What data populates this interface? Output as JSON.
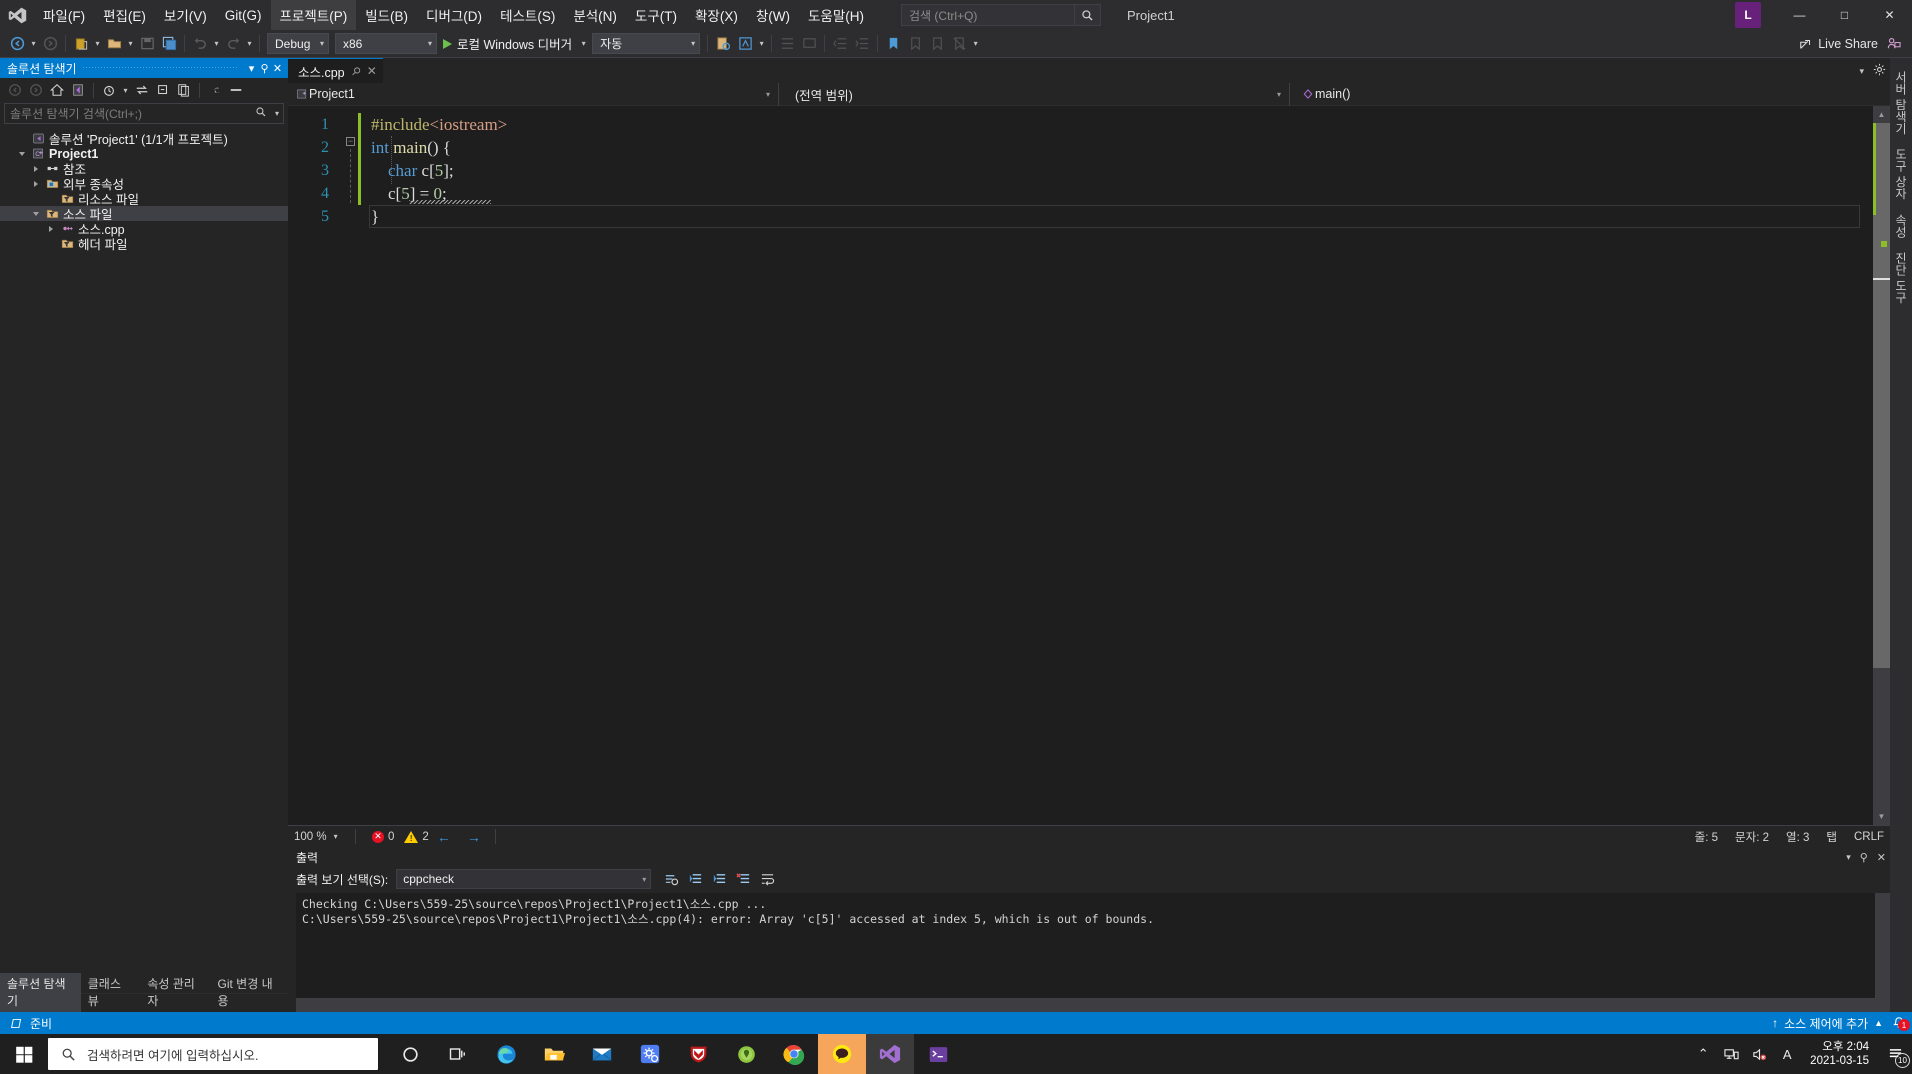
{
  "menubar": {
    "logo_icon": "visual-studio-logo",
    "items": [
      {
        "label": "파일(F)",
        "active": false
      },
      {
        "label": "편집(E)",
        "active": false
      },
      {
        "label": "보기(V)",
        "active": false
      },
      {
        "label": "Git(G)",
        "active": false
      },
      {
        "label": "프로젝트(P)",
        "active": true
      },
      {
        "label": "빌드(B)",
        "active": false
      },
      {
        "label": "디버그(D)",
        "active": false
      },
      {
        "label": "테스트(S)",
        "active": false
      },
      {
        "label": "분석(N)",
        "active": false
      },
      {
        "label": "도구(T)",
        "active": false
      },
      {
        "label": "확장(X)",
        "active": false
      },
      {
        "label": "창(W)",
        "active": false
      },
      {
        "label": "도움말(H)",
        "active": false
      }
    ],
    "search_placeholder": "검색 (Ctrl+Q)",
    "project_label": "Project1",
    "avatar_initial": "L",
    "minimize": "—",
    "maximize": "□",
    "close": "✕"
  },
  "toolbar": {
    "config": "Debug",
    "platform": "x86",
    "run_label": "로컬 Windows 디버거",
    "auto_label": "자동",
    "live_share": "Live Share"
  },
  "solution_explorer": {
    "title": "솔루션 탐색기",
    "pin_icon": "pin-icon",
    "close_icon": "close-icon",
    "minimize_icon": "chevron-down-icon",
    "search_placeholder": "솔루션 탐색기 검색(Ctrl+;)",
    "tree": [
      {
        "label": "솔루션 'Project1' (1/1개 프로젝트)",
        "indent": 0,
        "twisty": "none",
        "icon": "solution-icon",
        "bold": false,
        "selected": false
      },
      {
        "label": "Project1",
        "indent": 1,
        "twisty": "open",
        "icon": "cpp-project-icon",
        "bold": true,
        "selected": false
      },
      {
        "label": "참조",
        "indent": 2,
        "twisty": "closed",
        "icon": "references-icon",
        "bold": false,
        "selected": false
      },
      {
        "label": "외부 종속성",
        "indent": 2,
        "twisty": "closed",
        "icon": "ext-dep-icon",
        "bold": false,
        "selected": false
      },
      {
        "label": "리소스 파일",
        "indent": 3,
        "twisty": "none",
        "icon": "filter-folder-icon",
        "bold": false,
        "selected": false
      },
      {
        "label": "소스 파일",
        "indent": 2,
        "twisty": "open",
        "icon": "filter-folder-icon",
        "bold": false,
        "selected": true
      },
      {
        "label": "소스.cpp",
        "indent": 3,
        "twisty": "closed",
        "icon": "cpp-file-icon",
        "bold": false,
        "selected": false
      },
      {
        "label": "헤더 파일",
        "indent": 3,
        "twisty": "none",
        "icon": "filter-folder-icon",
        "bold": false,
        "selected": false
      }
    ],
    "bottom_tabs": [
      {
        "label": "솔루션 탐색기",
        "active": true
      },
      {
        "label": "클래스 뷰",
        "active": false
      },
      {
        "label": "속성 관리자",
        "active": false
      },
      {
        "label": "Git 변경 내용",
        "active": false
      }
    ]
  },
  "editor": {
    "tab_label": "소스.cpp",
    "tab_pin": "📌",
    "tab_close": "✕",
    "nav_project": "Project1",
    "nav_scope": "(전역 범위)",
    "nav_member": "main()",
    "code_lines": [
      {
        "num": "1",
        "tokens": [
          {
            "t": "#include",
            "c": "c-pre"
          },
          {
            "t": "<iostream>",
            "c": "c-inc"
          }
        ]
      },
      {
        "num": "2",
        "tokens": [
          {
            "t": "int ",
            "c": "c-kw"
          },
          {
            "t": "main",
            "c": "c-fn"
          },
          {
            "t": "() {",
            "c": "c-pl"
          }
        ]
      },
      {
        "num": "3",
        "tokens": [
          {
            "t": "    ",
            "c": "c-pl"
          },
          {
            "t": "char ",
            "c": "c-kw"
          },
          {
            "t": "c",
            "c": "c-pl"
          },
          {
            "t": "[",
            "c": "c-pl"
          },
          {
            "t": "5",
            "c": "c-num"
          },
          {
            "t": "];",
            "c": "c-pl"
          }
        ]
      },
      {
        "num": "4",
        "tokens": [
          {
            "t": "    c[",
            "c": "c-pl"
          },
          {
            "t": "5",
            "c": "c-num"
          },
          {
            "t": "] = ",
            "c": "c-pl"
          },
          {
            "t": "0",
            "c": "c-num"
          },
          {
            "t": ";",
            "c": "c-pl"
          }
        ]
      },
      {
        "num": "5",
        "tokens": [
          {
            "t": "}",
            "c": "c-pl"
          }
        ]
      }
    ],
    "status": {
      "zoom": "100 %",
      "error_count": "0",
      "warning_count": "2",
      "line": "줄: 5",
      "chars": "문자: 2",
      "col": "열: 3",
      "tab_mode": "탭",
      "eol": "CRLF"
    }
  },
  "output": {
    "title": "출력",
    "selector_label": "출력 보기 선택(S):",
    "selected_source": "cppcheck",
    "lines": [
      "Checking C:\\Users\\559-25\\source\\repos\\Project1\\Project1\\소스.cpp ...",
      "C:\\Users\\559-25\\source\\repos\\Project1\\Project1\\소스.cpp(4): error: Array 'c[5]' accessed at index 5, which is out of bounds."
    ]
  },
  "right_tabs": [
    {
      "label": "서버 탐색기"
    },
    {
      "label": "도구 상자"
    },
    {
      "label": "속성"
    },
    {
      "label": "진단 도구"
    }
  ],
  "vs_status": {
    "ready": "준비",
    "source_control": "소스 제어에 추가",
    "notification_count": "1"
  },
  "taskbar": {
    "search_placeholder": "검색하려면 여기에 입력하십시오.",
    "time": "오후 2:04",
    "date": "2021-03-15",
    "notification_count": "10",
    "apps": [
      {
        "name": "cortana-icon"
      },
      {
        "name": "task-view-icon"
      },
      {
        "name": "edge-icon"
      },
      {
        "name": "file-explorer-icon"
      },
      {
        "name": "mail-icon"
      },
      {
        "name": "settings-icon"
      },
      {
        "name": "mcafee-icon"
      },
      {
        "name": "alzip-icon"
      },
      {
        "name": "chrome-icon"
      },
      {
        "name": "kakaotalk-icon"
      },
      {
        "name": "visual-studio-icon"
      },
      {
        "name": "terminal-icon"
      }
    ]
  },
  "colors": {
    "accent": "#007acc",
    "error": "#e81123",
    "warning": "#ffcc00",
    "changebar": "#8cbf26"
  }
}
